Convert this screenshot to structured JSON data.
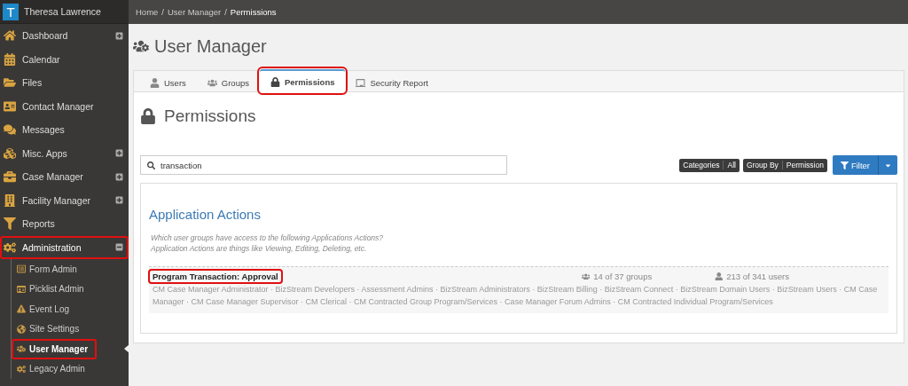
{
  "user": {
    "initial": "T",
    "name": "Theresa Lawrence"
  },
  "sidebar": {
    "items": [
      {
        "label": "Dashboard",
        "kind": "group",
        "expanded": false,
        "highlighted": false
      },
      {
        "label": "Calendar",
        "kind": "link",
        "highlighted": false
      },
      {
        "label": "Files",
        "kind": "link",
        "highlighted": false
      },
      {
        "label": "Contact Manager",
        "kind": "link",
        "highlighted": false
      },
      {
        "label": "Messages",
        "kind": "link",
        "highlighted": false
      },
      {
        "label": "Misc. Apps",
        "kind": "group",
        "expanded": false,
        "highlighted": false
      },
      {
        "label": "Case Manager",
        "kind": "group",
        "expanded": false,
        "highlighted": false
      },
      {
        "label": "Facility Manager",
        "kind": "group",
        "expanded": false,
        "highlighted": false
      },
      {
        "label": "Reports",
        "kind": "link",
        "highlighted": false
      },
      {
        "label": "Administration",
        "kind": "group",
        "expanded": true,
        "highlighted": true,
        "children": [
          {
            "label": "Form Admin",
            "selected": false,
            "highlighted": false
          },
          {
            "label": "Picklist Admin",
            "selected": false,
            "highlighted": false
          },
          {
            "label": "Event Log",
            "selected": false,
            "highlighted": false
          },
          {
            "label": "Site Settings",
            "selected": false,
            "highlighted": false
          },
          {
            "label": "User Manager",
            "selected": true,
            "highlighted": true
          },
          {
            "label": "Legacy Admin",
            "selected": false,
            "highlighted": false
          }
        ]
      }
    ]
  },
  "breadcrumb": [
    {
      "label": "Home",
      "separator": "/"
    },
    {
      "label": "User Manager",
      "separator": "/"
    },
    {
      "label": "Permissions"
    }
  ],
  "page_title": "User Manager",
  "tabs": [
    {
      "label": "Users",
      "selected": false,
      "highlighted": false
    },
    {
      "label": "Groups",
      "selected": false,
      "highlighted": false
    },
    {
      "label": "Permissions",
      "selected": true,
      "highlighted": true
    },
    {
      "label": "Security Report",
      "selected": false,
      "highlighted": false
    }
  ],
  "section_title": "Permissions",
  "search": {
    "value": "transaction"
  },
  "filters": [
    {
      "label": "Categories",
      "value": "All"
    },
    {
      "label": "Group By",
      "value": "Permission"
    }
  ],
  "filter_button": {
    "label": "Filter"
  },
  "category": {
    "title": "Application Actions",
    "description": [
      "Which user groups have access to the following Applications Actions?",
      "Application Actions are things like Viewing, Editing, Deleting, etc."
    ]
  },
  "permissions": [
    {
      "name": "Program Transaction: Approval",
      "highlighted": true,
      "groups_count": "14 of 37 groups",
      "users_count": "213 of 341 users",
      "groups": "CM Case Manager Administrator · BizStream Developers · Assessment Admins · BizStream Administrators · BizStream Billing · BizStream Connect · BizStream Domain Users · BizStream Users · CM Case Manager · CM Case Manager Supervisor · CM Clerical · CM Contracted Group Program/Services · Case Manager Forum Admins · CM Contracted Individual Program/Services"
    }
  ]
}
